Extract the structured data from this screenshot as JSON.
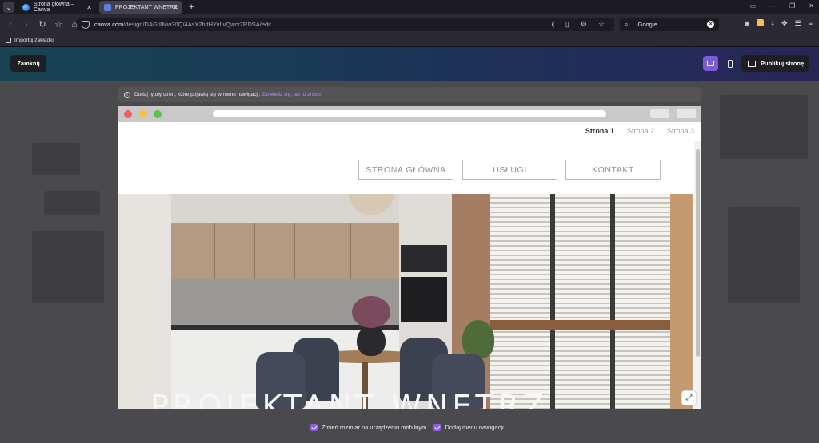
{
  "browser": {
    "tabs": [
      {
        "title": "Strona główna – Canva",
        "active": false,
        "icon": "canva-logo-icon"
      },
      {
        "title": "PROJEKTANT WNĘTRZ",
        "active": true,
        "icon": "document-icon"
      }
    ],
    "url_domain": "canva.com",
    "url_path": "/design/DAGtIlMw30Q/4AsX2fvtHYvLvQwcr7RDSA/edit",
    "search_engine": "Google",
    "bookmarks": [
      {
        "label": "Importuj zakładki",
        "icon": "import-icon"
      }
    ]
  },
  "canva": {
    "close_label": "Zamknij",
    "publish_label": "Publikuj stronę",
    "info_text": "Dodaj tytuły stron, które pojawią się w menu nawigacji.",
    "info_link": "Dowiedz się, jak to zrobić",
    "options": [
      {
        "label": "Zmień rozmiar na urządzeniu mobilnym",
        "checked": true
      },
      {
        "label": "Dodaj menu nawigacji",
        "checked": true
      }
    ],
    "accent_color": "#8b5cf6"
  },
  "preview": {
    "page_nav": [
      "Strona 1",
      "Strona 2",
      "Strona 3"
    ],
    "active_page": "Strona 1",
    "site_buttons": [
      "STRONA GŁÓWNA",
      "USŁUGI",
      "KONTAKT"
    ],
    "hero_title": "PROJEKTANT WNĘTRZ"
  }
}
